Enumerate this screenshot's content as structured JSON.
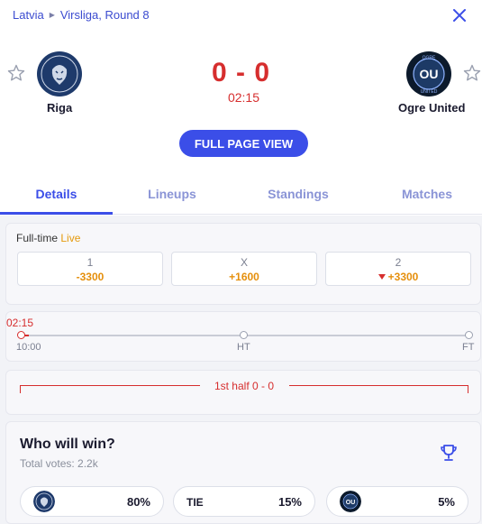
{
  "breadcrumb": {
    "country": "Latvia",
    "league": "Virsliga, Round 8"
  },
  "match": {
    "home": {
      "name": "Riga"
    },
    "away": {
      "name": "Ogre United",
      "logo_text": "OU",
      "logo_ring": "OGRE UNITED"
    },
    "score": "0 - 0",
    "clock": "02:15"
  },
  "actions": {
    "full_page_view": "FULL PAGE VIEW"
  },
  "tabs": [
    {
      "label": "Details",
      "active": true
    },
    {
      "label": "Lineups",
      "active": false
    },
    {
      "label": "Standings",
      "active": false
    },
    {
      "label": "Matches",
      "active": false
    }
  ],
  "odds": {
    "status": "Full-time",
    "live": "Live",
    "items": [
      {
        "key": "1",
        "value": "-3300",
        "trend": "none"
      },
      {
        "key": "X",
        "value": "+1600",
        "trend": "none"
      },
      {
        "key": "2",
        "value": "+3300",
        "trend": "down"
      }
    ]
  },
  "timeline": {
    "current": "02:15",
    "start": "10:00",
    "mid": "HT",
    "end": "FT",
    "progress_fraction": 0.01
  },
  "half": {
    "label": "1st half 0 - 0"
  },
  "poll": {
    "title": "Who will win?",
    "votes": "Total votes: 2.2k",
    "home_pct": "80%",
    "tie_label": "TIE",
    "tie_pct": "15%",
    "away_pct": "5%"
  },
  "colors": {
    "accent": "#3b4ee8",
    "live": "#e59a0c",
    "score": "#d62e2e",
    "odds": "#e58f0c"
  },
  "icons": {
    "close": "close-icon",
    "star": "star-icon",
    "trophy": "trophy-icon",
    "arrow": "triangle-right-icon"
  }
}
